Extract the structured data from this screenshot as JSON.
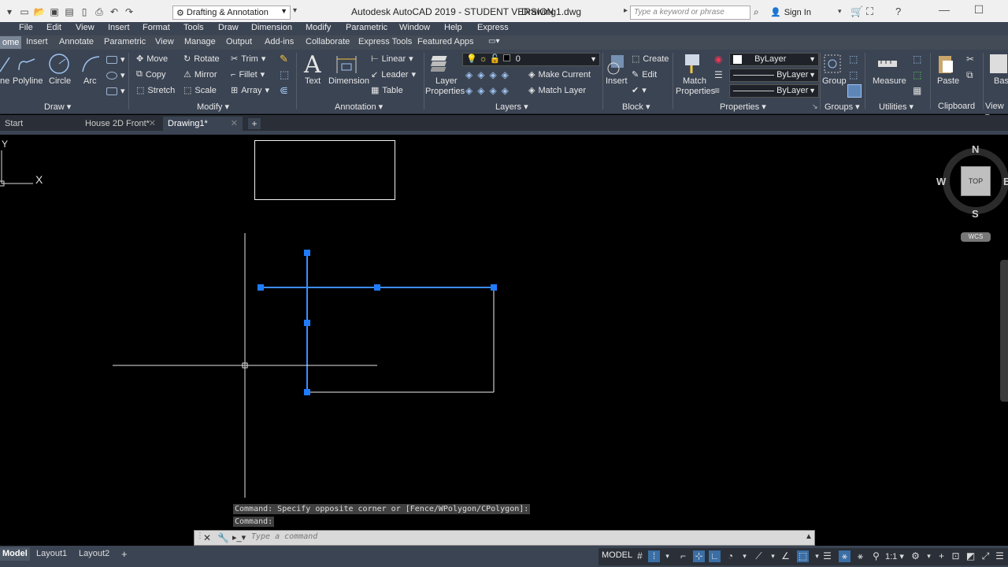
{
  "title_bar": {
    "workspace": "Drafting & Annotation",
    "app_title": "Autodesk AutoCAD 2019 - STUDENT VERSION",
    "doc_title": "Drawing1.dwg",
    "search_placeholder": "Type a keyword or phrase",
    "sign_in": "Sign In"
  },
  "menu": [
    "File",
    "Edit",
    "View",
    "Insert",
    "Format",
    "Tools",
    "Draw",
    "Dimension",
    "Modify",
    "Parametric",
    "Window",
    "Help",
    "Express"
  ],
  "ribbon_tabs": {
    "home": "ome",
    "insert": "Insert",
    "annotate": "Annotate",
    "parametric": "Parametric",
    "view": "View",
    "manage": "Manage",
    "output": "Output",
    "addins": "Add-ins",
    "collaborate": "Collaborate",
    "express": "Express Tools",
    "featured": "Featured Apps"
  },
  "ribbon": {
    "draw": {
      "polyline": "Polyline",
      "circle": "Circle",
      "arc": "Arc",
      "line": "ne",
      "title": "Draw"
    },
    "modify": {
      "move": "Move",
      "rotate": "Rotate",
      "trim": "Trim",
      "copy": "Copy",
      "mirror": "Mirror",
      "fillet": "Fillet",
      "stretch": "Stretch",
      "scale": "Scale",
      "array": "Array",
      "title": "Modify"
    },
    "annotation": {
      "text": "Text",
      "dimension": "Dimension",
      "linear": "Linear",
      "leader": "Leader",
      "table": "Table",
      "title": "Annotation"
    },
    "layers": {
      "layer_properties_1": "Layer",
      "layer_properties_2": "Properties",
      "current_layer": "0",
      "make_current": "Make Current",
      "match_layer": "Match Layer",
      "title": "Layers"
    },
    "block": {
      "insert": "Insert",
      "create": "Create",
      "edit": "Edit",
      "title": "Block"
    },
    "properties": {
      "match_1": "Match",
      "match_2": "Properties",
      "color": "ByLayer",
      "linetype": "ByLayer",
      "lineweight": "ByLayer",
      "title": "Properties"
    },
    "groups": {
      "group": "Group",
      "title": "Groups"
    },
    "utilities": {
      "measure": "Measure",
      "title": "Utilities"
    },
    "clipboard": {
      "paste": "Paste",
      "title": "Clipboard"
    },
    "view": {
      "base": "Base",
      "title": "View"
    }
  },
  "doc_tabs": {
    "start": "Start",
    "house": "House 2D Front*",
    "drawing1": "Drawing1*"
  },
  "ucs": {
    "y": "Y",
    "x": "X"
  },
  "viewcube": {
    "n": "N",
    "s": "S",
    "w": "W",
    "e": "E",
    "top": "TOP",
    "wcs": "WCS"
  },
  "command": {
    "history_1": "Command: Specify opposite corner or [Fence/WPolygon/CPolygon]:",
    "history_2": "Command:",
    "placeholder": "Type a command"
  },
  "layout_tabs": {
    "model": "Model",
    "layout1": "Layout1",
    "layout2": "Layout2"
  },
  "status": {
    "model": "MODEL",
    "scale": "1:1"
  },
  "colors": {
    "selection": "#3c8cff",
    "grip": "#1f7bff",
    "canvas": "#000000",
    "ribbon": "#3b4453"
  }
}
